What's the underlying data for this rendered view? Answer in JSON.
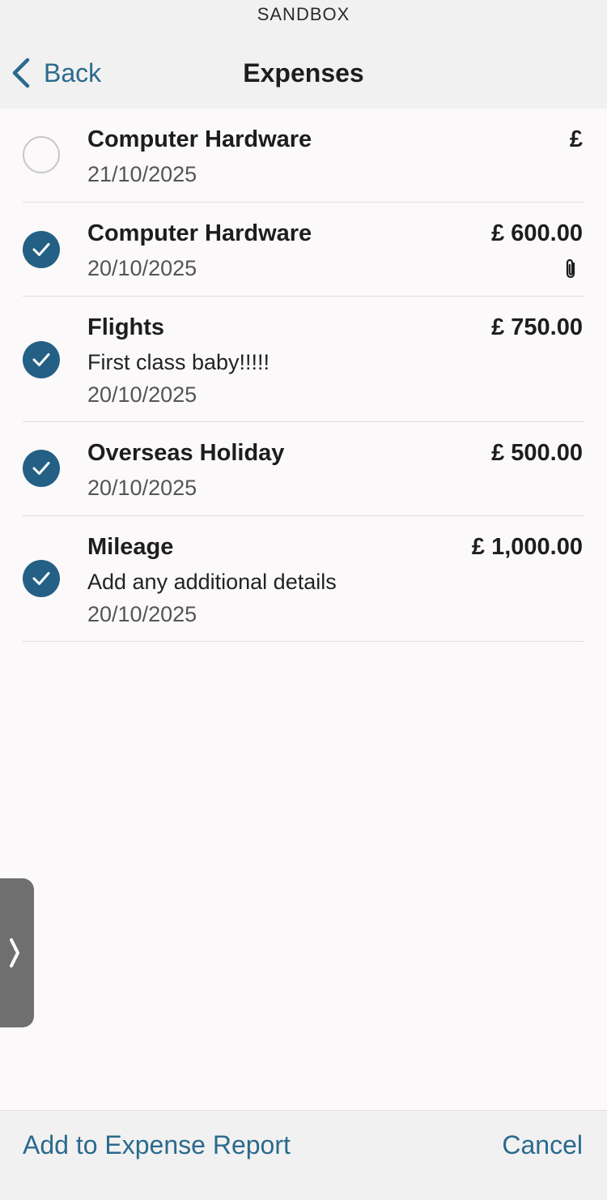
{
  "banner": {
    "text": "SANDBOX"
  },
  "nav": {
    "back_label": "Back",
    "title": "Expenses"
  },
  "expenses": [
    {
      "title": "Computer Hardware",
      "date": "21/10/2025",
      "amount": "£",
      "selected": false
    },
    {
      "title": "Computer Hardware",
      "date": "20/10/2025",
      "amount": "£ 600.00",
      "selected": true,
      "has_attachment": true
    },
    {
      "title": "Flights",
      "description": "First class baby!!!!!",
      "date": "20/10/2025",
      "amount": "£ 750.00",
      "selected": true
    },
    {
      "title": "Overseas Holiday",
      "date": "20/10/2025",
      "amount": "£ 500.00",
      "selected": true
    },
    {
      "title": "Mileage",
      "description": "Add any additional details",
      "date": "20/10/2025",
      "amount": "£ 1,000.00",
      "selected": true
    }
  ],
  "footer": {
    "add_label": "Add to Expense Report",
    "cancel_label": "Cancel"
  },
  "icons": {
    "back": "chevron-left-icon",
    "checked": "checkmark-circle-icon",
    "unchecked": "empty-circle-icon",
    "attachment": "paperclip-icon",
    "drawer": "chevron-right-icon"
  },
  "colors": {
    "accent": "#2a6a8e",
    "check_fill": "#246085"
  }
}
